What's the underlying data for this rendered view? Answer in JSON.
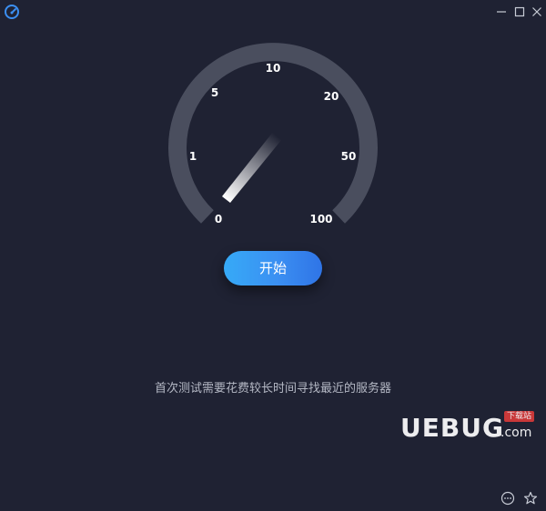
{
  "window": {
    "app_icon": "speedometer-icon",
    "controls": {
      "minimize_icon": "minimize-icon",
      "maximize_icon": "maximize-icon",
      "close_icon": "close-icon"
    }
  },
  "gauge": {
    "scale_labels": [
      "0",
      "1",
      "5",
      "10",
      "20",
      "50",
      "100"
    ],
    "track_color": "#4a4e5e",
    "needle_value": "0"
  },
  "start_button": {
    "label": "开始"
  },
  "hint": {
    "text": "首次测试需要花费较长时间寻找最近的服务器"
  },
  "watermark": {
    "brand": "UEBUG",
    "suffix": ".com",
    "badge": "下载站"
  },
  "footer": {
    "more_icon": "more-options-icon",
    "favorite_icon": "star-icon"
  },
  "colors": {
    "background": "#1f2233",
    "accent": "#3b8ff2"
  }
}
